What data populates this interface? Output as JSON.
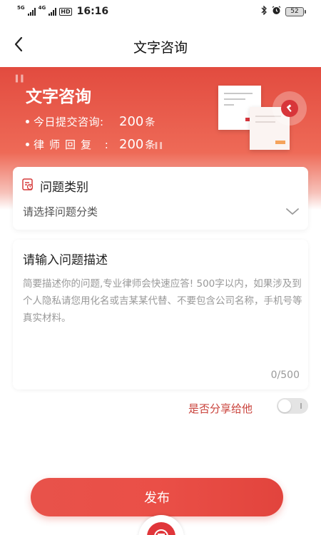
{
  "status_bar": {
    "net1": "5G",
    "net2": "4G",
    "hd": "HD",
    "time": "16:16",
    "battery": "52",
    "icons": [
      "signal-icon",
      "signal-icon",
      "hd-icon",
      "bluetooth-icon",
      "alarm-icon",
      "battery-icon"
    ]
  },
  "nav": {
    "title": "文字咨询",
    "back_icon": "chevron-left-icon"
  },
  "banner": {
    "title": "文字咨询",
    "stats": [
      {
        "label": "今日提交咨询:",
        "value": "200",
        "unit": "条"
      },
      {
        "label": "律师回复  :",
        "value": "200",
        "unit": "条"
      }
    ],
    "accent": "#e24b3f"
  },
  "category": {
    "title": "问题类别",
    "placeholder": "请选择问题分类",
    "icon": "document-question-icon"
  },
  "description": {
    "title": "请输入问题描述",
    "placeholder": "简要描述你的问题,专业律师会快速应答! 500字以内，如果涉及到个人隐私请您用化名或吉某某代替、不要包含公司名称，手机号等真实材料。",
    "counter": "0/500"
  },
  "share": {
    "label": "是否分享给他",
    "enabled": false
  },
  "submit": {
    "label": "发布"
  }
}
